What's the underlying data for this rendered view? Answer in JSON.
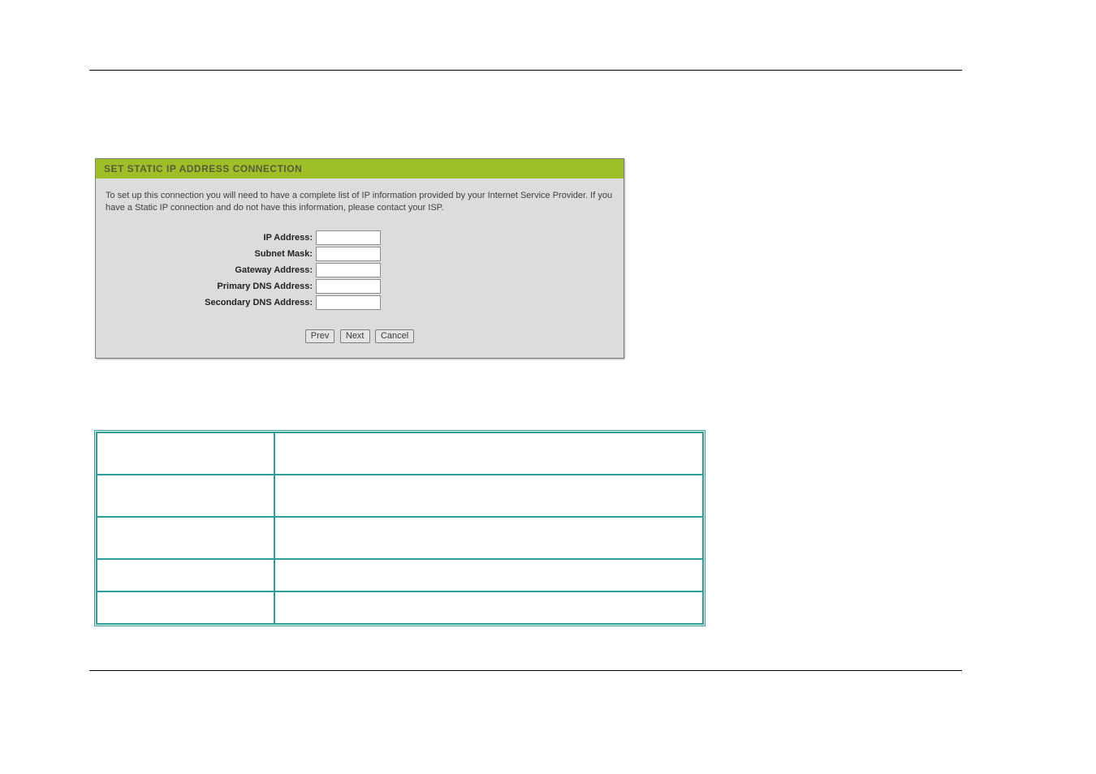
{
  "panel": {
    "title": "SET STATIC IP ADDRESS CONNECTION",
    "description": "To set up this connection you will need to have a complete list of IP information provided by your Internet Service Provider. If you have a Static IP connection and do not have this information, please contact your ISP.",
    "fields": {
      "ip_address": {
        "label": "IP Address:",
        "value": ""
      },
      "subnet_mask": {
        "label": "Subnet Mask:",
        "value": ""
      },
      "gateway": {
        "label": "Gateway Address:",
        "value": ""
      },
      "primary_dns": {
        "label": "Primary DNS Address:",
        "value": ""
      },
      "secondary_dns": {
        "label": "Secondary DNS Address:",
        "value": ""
      }
    },
    "buttons": {
      "prev": "Prev",
      "next": "Next",
      "cancel": "Cancel"
    }
  },
  "table": {
    "rows": [
      {
        "a": "",
        "b": ""
      },
      {
        "a": "",
        "b": ""
      },
      {
        "a": "",
        "b": ""
      },
      {
        "a": "",
        "b": ""
      },
      {
        "a": "",
        "b": ""
      }
    ]
  }
}
